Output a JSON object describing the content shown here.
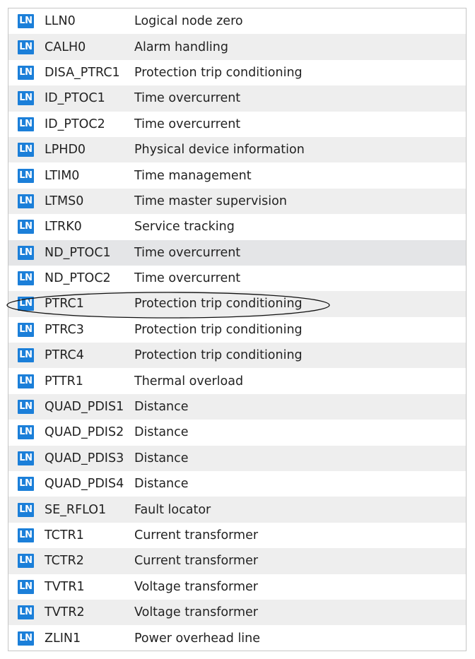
{
  "badge_label": "LN",
  "colors": {
    "badge": "#1b7fd9",
    "row_alt": "#eeeeee",
    "row_selected": "#e4e5e7"
  },
  "rows": [
    {
      "name": "LLN0",
      "description": "Logical node zero"
    },
    {
      "name": "CALH0",
      "description": "Alarm handling"
    },
    {
      "name": "DISA_PTRC1",
      "description": "Protection trip conditioning"
    },
    {
      "name": "ID_PTOC1",
      "description": "Time overcurrent"
    },
    {
      "name": "ID_PTOC2",
      "description": "Time overcurrent"
    },
    {
      "name": "LPHD0",
      "description": "Physical device information"
    },
    {
      "name": "LTIM0",
      "description": "Time management"
    },
    {
      "name": "LTMS0",
      "description": "Time master supervision"
    },
    {
      "name": "LTRK0",
      "description": "Service tracking"
    },
    {
      "name": "ND_PTOC1",
      "description": "Time overcurrent"
    },
    {
      "name": "ND_PTOC2",
      "description": "Time overcurrent"
    },
    {
      "name": "PTRC1",
      "description": "Protection trip conditioning"
    },
    {
      "name": "PTRC3",
      "description": "Protection trip conditioning"
    },
    {
      "name": "PTRC4",
      "description": "Protection trip conditioning"
    },
    {
      "name": "PTTR1",
      "description": "Thermal overload"
    },
    {
      "name": "QUAD_PDIS1",
      "description": "Distance"
    },
    {
      "name": "QUAD_PDIS2",
      "description": "Distance"
    },
    {
      "name": "QUAD_PDIS3",
      "description": "Distance"
    },
    {
      "name": "QUAD_PDIS4",
      "description": "Distance"
    },
    {
      "name": "SE_RFLO1",
      "description": "Fault locator"
    },
    {
      "name": "TCTR1",
      "description": "Current transformer"
    },
    {
      "name": "TCTR2",
      "description": "Current transformer"
    },
    {
      "name": "TVTR1",
      "description": "Voltage transformer"
    },
    {
      "name": "TVTR2",
      "description": "Voltage transformer"
    },
    {
      "name": "ZLIN1",
      "description": "Power overhead line"
    }
  ],
  "selected_index": 9,
  "highlighted_index": 11
}
